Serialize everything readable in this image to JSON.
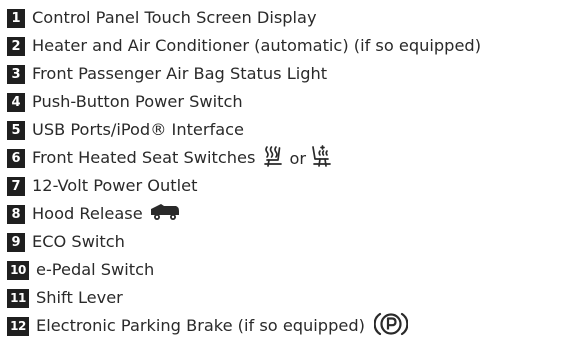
{
  "items": [
    {
      "number": "1",
      "label": "Control Panel Touch Screen Display"
    },
    {
      "number": "2",
      "label": "Heater and Air Conditioner (automatic) (if so equipped)"
    },
    {
      "number": "3",
      "label": "Front Passenger Air Bag Status Light"
    },
    {
      "number": "4",
      "label": "Push-Button Power Switch"
    },
    {
      "number": "5",
      "label": "USB Ports/iPod® Interface"
    },
    {
      "number": "6",
      "label": "Front Heated Seat Switches",
      "icons": [
        "heated-seat-icon",
        "heated-seat-backrest-icon"
      ],
      "separator": "or"
    },
    {
      "number": "7",
      "label": "12-Volt Power Outlet"
    },
    {
      "number": "8",
      "label": "Hood Release",
      "icons": [
        "hood-release-icon"
      ]
    },
    {
      "number": "9",
      "label": "ECO Switch"
    },
    {
      "number": "10",
      "label": "e-Pedal Switch"
    },
    {
      "number": "11",
      "label": "Shift Lever"
    },
    {
      "number": "12",
      "label": "Electronic Parking Brake (if so equipped)",
      "icons": [
        "parking-brake-icon"
      ]
    }
  ]
}
